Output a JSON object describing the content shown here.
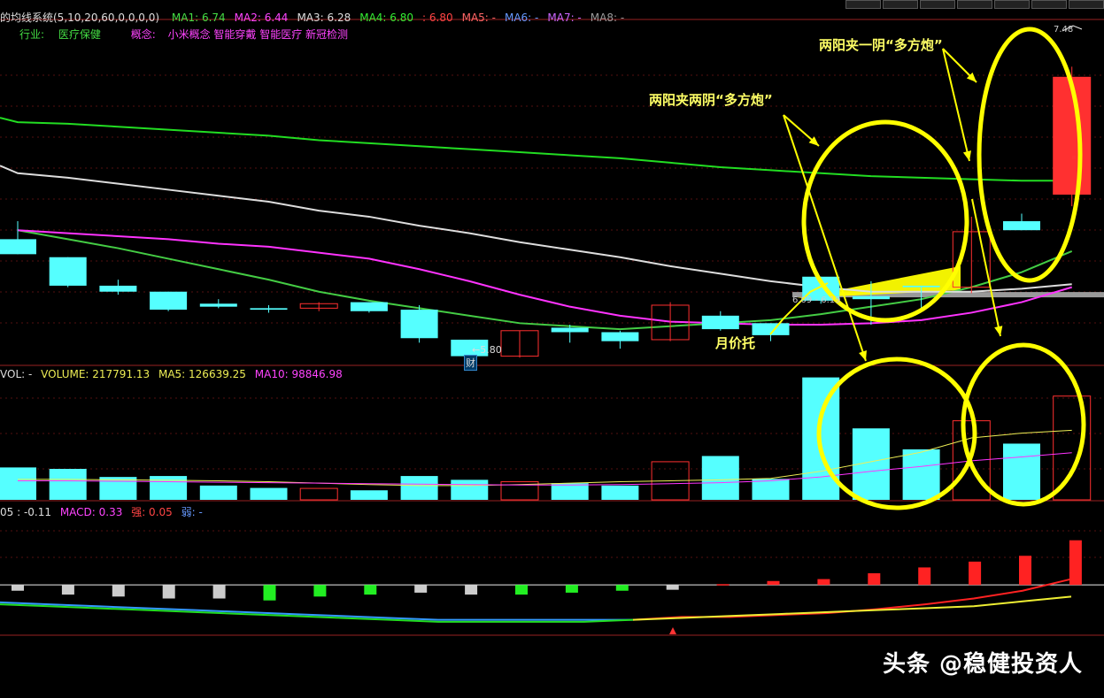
{
  "header": {
    "system_label": "的均线系统(5,10,20,60,0,0,0,0)",
    "ma_items": [
      {
        "label": "MA1: 6.74",
        "color": "#44dd44"
      },
      {
        "label": "MA2: 6.44",
        "color": "#ff44ff"
      },
      {
        "label": "MA3: 6.28",
        "color": "#dddddd"
      },
      {
        "label": "MA4: 6.80",
        "color": "#33ee33"
      },
      {
        "label": ": 6.80",
        "color": "#ff4444"
      },
      {
        "label": "MA5: -",
        "color": "#ff6666"
      },
      {
        "label": "MA6: -",
        "color": "#6699ff"
      },
      {
        "label": "MA7: -",
        "color": "#cc66ff"
      },
      {
        "label": "MA8: -",
        "color": "#999999"
      }
    ],
    "industry_label": "行业:",
    "industry_value": "医疗保健",
    "concept_label": "概念:",
    "concept_value": "小米概念 智能穿戴 智能医疗 新冠检测"
  },
  "volume_header": {
    "vol": "VOL: -",
    "volume": "VOLUME: 217791.13",
    "ma5": "MA5: 126639.25",
    "ma10": "MA10: 98846.98"
  },
  "macd_header": {
    "a": "05 : -0.11",
    "macd": "MACD: 0.33",
    "strong": "强: 0.05",
    "weak": "弱: -"
  },
  "annotations": {
    "two_yang_two_yin": "两阳夹两阴“多方炮”",
    "two_yang_one_yin": "两阳夹一阴“多方炮”",
    "monthly_support": "月价托",
    "low_price": "5.80",
    "cai_marker": "财",
    "support_range": "6.09 - 6.19",
    "high_price": "7.48"
  },
  "watermark": "头条 @稳健投资人",
  "colors": {
    "up": "#ff3030",
    "down": "#55ffff",
    "annotation": "#ffff00"
  },
  "chart_data": {
    "type": "candlestick",
    "price_axis": {
      "min": 5.6,
      "max": 7.7
    },
    "candles": [
      {
        "o": 6.4,
        "h": 6.52,
        "l": 6.3,
        "c": 6.3
      },
      {
        "o": 6.28,
        "h": 6.28,
        "l": 6.08,
        "c": 6.09
      },
      {
        "o": 6.09,
        "h": 6.13,
        "l": 6.03,
        "c": 6.05
      },
      {
        "o": 6.05,
        "h": 6.05,
        "l": 5.92,
        "c": 5.93
      },
      {
        "o": 5.97,
        "h": 6.0,
        "l": 5.94,
        "c": 5.95
      },
      {
        "o": 5.94,
        "h": 5.96,
        "l": 5.91,
        "c": 5.93
      },
      {
        "o": 5.94,
        "h": 5.98,
        "l": 5.92,
        "c": 5.97
      },
      {
        "o": 5.98,
        "h": 5.98,
        "l": 5.91,
        "c": 5.92
      },
      {
        "o": 5.93,
        "h": 5.96,
        "l": 5.71,
        "c": 5.74
      },
      {
        "o": 5.73,
        "h": 5.73,
        "l": 5.6,
        "c": 5.62
      },
      {
        "o": 5.62,
        "h": 5.79,
        "l": 5.61,
        "c": 5.79
      },
      {
        "o": 5.81,
        "h": 5.83,
        "l": 5.71,
        "c": 5.78
      },
      {
        "o": 5.78,
        "h": 5.79,
        "l": 5.67,
        "c": 5.72
      },
      {
        "o": 5.73,
        "h": 5.98,
        "l": 5.72,
        "c": 5.96
      },
      {
        "o": 5.89,
        "h": 5.92,
        "l": 5.79,
        "c": 5.8
      },
      {
        "o": 5.84,
        "h": 5.84,
        "l": 5.72,
        "c": 5.76
      },
      {
        "o": 6.15,
        "h": 6.15,
        "l": 5.97,
        "c": 5.99
      },
      {
        "o": 6.02,
        "h": 6.12,
        "l": 5.83,
        "c": 6.0
      },
      {
        "o": 6.09,
        "h": 6.09,
        "l": 5.94,
        "c": 6.08
      },
      {
        "o": 6.08,
        "h": 6.55,
        "l": 6.04,
        "c": 6.45
      },
      {
        "o": 6.52,
        "h": 6.57,
        "l": 6.46,
        "c": 6.46
      },
      {
        "o": 6.7,
        "h": 7.55,
        "l": 6.62,
        "c": 7.48
      }
    ],
    "ma_lines": [
      {
        "name": "MA1",
        "color": "#44cc44",
        "values": [
          6.46,
          6.4,
          6.34,
          6.27,
          6.2,
          6.13,
          6.05,
          5.99,
          5.94,
          5.89,
          5.84,
          5.82,
          5.8,
          5.82,
          5.84,
          5.86,
          5.9,
          5.95,
          6.0,
          6.08,
          6.18,
          6.32
        ]
      },
      {
        "name": "MA2",
        "color": "#ff33ff",
        "values": [
          6.46,
          6.44,
          6.42,
          6.4,
          6.37,
          6.35,
          6.31,
          6.27,
          6.2,
          6.12,
          6.03,
          5.95,
          5.89,
          5.85,
          5.84,
          5.83,
          5.83,
          5.84,
          5.86,
          5.91,
          5.98,
          6.08
        ]
      },
      {
        "name": "MA3",
        "color": "#dddddd",
        "values": [
          6.84,
          6.81,
          6.77,
          6.73,
          6.69,
          6.65,
          6.59,
          6.55,
          6.49,
          6.44,
          6.38,
          6.33,
          6.28,
          6.22,
          6.17,
          6.12,
          6.08,
          6.05,
          6.05,
          6.05,
          6.07,
          6.1
        ]
      },
      {
        "name": "MA4",
        "color": "#22dd22",
        "values": [
          7.18,
          7.17,
          7.15,
          7.13,
          7.11,
          7.09,
          7.06,
          7.04,
          7.02,
          7.0,
          6.98,
          6.96,
          6.94,
          6.91,
          6.88,
          6.86,
          6.84,
          6.82,
          6.81,
          6.8,
          6.79,
          6.79
        ]
      }
    ],
    "volume": {
      "max": 260000,
      "values": [
        68000,
        65000,
        48000,
        50000,
        30000,
        25000,
        24000,
        20000,
        50000,
        42000,
        38000,
        35000,
        30000,
        80000,
        92000,
        44000,
        257000,
        150000,
        106000,
        166000,
        118000,
        217791
      ],
      "ma5": [
        43000,
        43000,
        42000,
        41000,
        40000,
        38000,
        35000,
        32000,
        30000,
        30000,
        32000,
        35000,
        38000,
        40000,
        42000,
        45000,
        60000,
        80000,
        100000,
        130000,
        140000,
        146000
      ],
      "ma10": [
        40000,
        40000,
        39000,
        38000,
        37000,
        36000,
        35000,
        34000,
        33000,
        32000,
        31000,
        31000,
        32000,
        34000,
        36000,
        40000,
        48000,
        60000,
        70000,
        82000,
        90000,
        98846
      ]
    },
    "macd": {
      "bars": [
        -0.03,
        -0.05,
        -0.06,
        -0.07,
        -0.07,
        -0.08,
        -0.06,
        -0.05,
        -0.04,
        -0.05,
        -0.05,
        -0.04,
        -0.03,
        -0.025,
        0.004,
        0.02,
        0.03,
        0.06,
        0.09,
        0.12,
        0.15,
        0.23,
        0.31,
        0.33
      ],
      "dif": [
        -0.09,
        -0.1,
        -0.11,
        -0.12,
        -0.13,
        -0.14,
        -0.15,
        -0.16,
        -0.17,
        -0.18,
        -0.18,
        -0.18,
        -0.18,
        -0.18,
        -0.165,
        -0.165,
        -0.155,
        -0.145,
        -0.125,
        -0.1,
        -0.07,
        -0.03,
        0.03
      ],
      "dea": [
        -0.1,
        -0.11,
        -0.12,
        -0.13,
        -0.14,
        -0.15,
        -0.16,
        -0.17,
        -0.18,
        -0.19,
        -0.19,
        -0.19,
        -0.19,
        -0.18,
        -0.17,
        -0.16,
        -0.15,
        -0.14,
        -0.13,
        -0.12,
        -0.11,
        -0.085,
        -0.06
      ],
      "range": [
        -0.25,
        0.37
      ]
    }
  }
}
